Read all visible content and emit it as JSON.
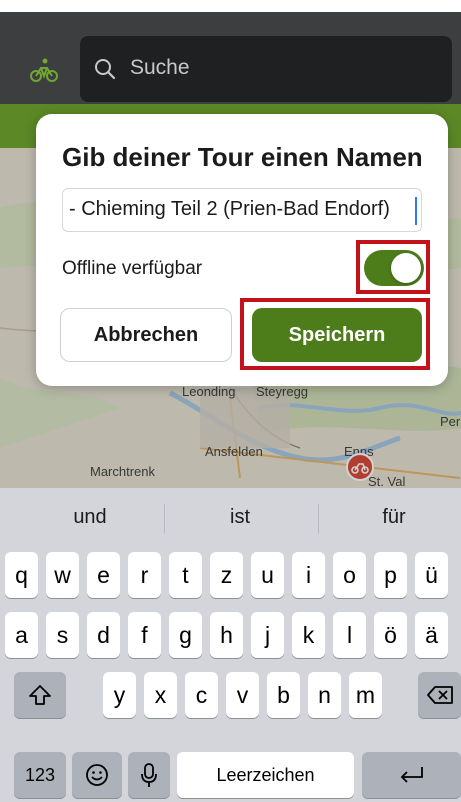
{
  "header": {
    "search_placeholder": "Suche",
    "accent_color": "#71a82f"
  },
  "map": {
    "labels": [
      "Leonding",
      "Steyregg",
      "Ansfelden",
      "Marchtrenk",
      "Enns",
      "St. Val",
      "Per"
    ]
  },
  "dialog": {
    "title": "Gib deiner Tour einen Namen",
    "name_value": "- Chieming Teil 2 (Prien-Bad Endorf)",
    "offline_label": "Offline verfügbar",
    "offline_enabled": true,
    "cancel_label": "Abbrechen",
    "save_label": "Speichern",
    "highlight_color": "#c3121a"
  },
  "keyboard": {
    "suggestions": [
      "und",
      "ist",
      "für"
    ],
    "row1": [
      "q",
      "w",
      "e",
      "r",
      "t",
      "z",
      "u",
      "i",
      "o",
      "p",
      "ü"
    ],
    "row2": [
      "a",
      "s",
      "d",
      "f",
      "g",
      "h",
      "j",
      "k",
      "l",
      "ö",
      "ä"
    ],
    "row3": [
      "y",
      "x",
      "c",
      "v",
      "b",
      "n",
      "m"
    ],
    "numbers_label": "123",
    "space_label": "Leerzeichen"
  }
}
